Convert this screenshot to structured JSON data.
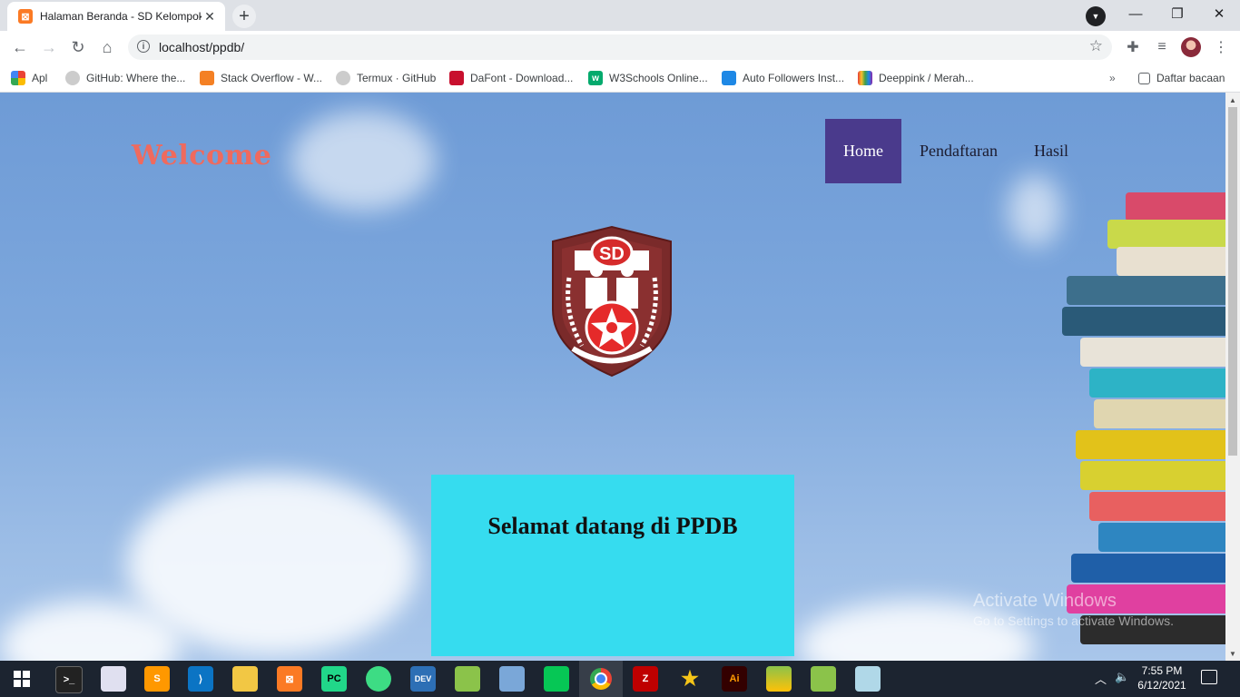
{
  "browser": {
    "tab_title": "Halaman Beranda - SD Kelompok",
    "url": "localhost/ppdb/",
    "bookmarks": [
      {
        "label": "Apl",
        "icon": "apps-grid-icon"
      },
      {
        "label": "GitHub: Where the...",
        "icon": "github-icon"
      },
      {
        "label": "Stack Overflow - W...",
        "icon": "stackoverflow-icon"
      },
      {
        "label": "Termux · GitHub",
        "icon": "github-icon"
      },
      {
        "label": "DaFont - Download...",
        "icon": "dafont-icon"
      },
      {
        "label": "W3Schools Online...",
        "icon": "w3schools-icon"
      },
      {
        "label": "Auto Followers Inst...",
        "icon": "cube-icon"
      },
      {
        "label": "Deeppink / Merah...",
        "icon": "colorbook-icon"
      }
    ],
    "reading_list_label": "Daftar bacaan"
  },
  "page": {
    "welcome_text": "Welcome",
    "nav": [
      {
        "label": "Home",
        "active": true
      },
      {
        "label": "Pendaftaran",
        "active": false
      },
      {
        "label": "Hasil",
        "active": false
      }
    ],
    "logo_text": "SD",
    "headline": "Selamat datang di PPDB"
  },
  "overlay": {
    "activate_title": "Activate Windows",
    "activate_sub": "Go to Settings to activate Windows."
  },
  "taskbar": {
    "apps": [
      "terminal-icon",
      "paint-icon",
      "sublime-text-icon",
      "vscode-icon",
      "file-explorer-icon",
      "xampp-icon",
      "pycharm-icon",
      "android-studio-icon",
      "devcpp-icon",
      "notepad-icon",
      "virtualbox-icon",
      "line-icon",
      "chrome-icon",
      "filezilla-icon",
      "star-app-icon",
      "illustrator-icon",
      "bluestacks-icon",
      "android-apk-icon",
      "notes-icon"
    ],
    "time": "7:55 PM",
    "date": "6/12/2021"
  },
  "colors": {
    "nav_active": "#4a3a8c",
    "welcome_text": "#ef6a5e",
    "headline_box": "#36dcef",
    "taskbar": "#1c2430"
  }
}
